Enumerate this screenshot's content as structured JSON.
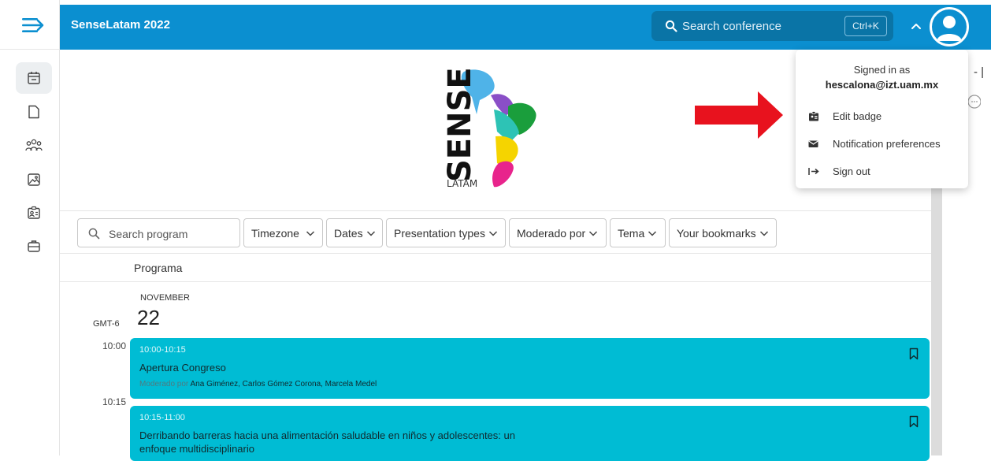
{
  "topbar": {
    "title": "SenseLatam 2022",
    "search_placeholder": "Search conference",
    "search_shortcut": "Ctrl+K"
  },
  "rail": {
    "items": [
      "calendar-icon",
      "document-icon",
      "people-icon",
      "image-icon",
      "badge-icon",
      "briefcase-icon"
    ]
  },
  "logo": {
    "text": "SENSE",
    "subtext": "LATAM"
  },
  "filters": {
    "search_placeholder": "Search program",
    "chips": [
      "Timezone",
      "Dates",
      "Presentation types",
      "Moderado por",
      "Tema",
      "Your bookmarks"
    ]
  },
  "program": {
    "heading": "Programa",
    "month": "NOVEMBER",
    "timezone": "GMT-6",
    "day": "22",
    "events": [
      {
        "start": "10:00",
        "range": "10:00-10:15",
        "title": "Apertura Congreso",
        "moderator_label": "Moderado por",
        "moderators": "Ana Giménez, Carlos Gómez Corona, Marcela Medel"
      },
      {
        "start": "10:15",
        "range": "10:15-11:00",
        "title_line1": "Derribando barreras hacia una alimentación saludable en niños y adolescentes: un",
        "title_line2": "enfoque multidisciplinario"
      }
    ]
  },
  "user_menu": {
    "signed_in_label": "Signed in as",
    "email": "hescalona@izt.uam.mx",
    "items": [
      {
        "label": "Edit badge",
        "icon": "badge-edit-icon"
      },
      {
        "label": "Notification preferences",
        "icon": "envelope-icon"
      },
      {
        "label": "Sign out",
        "icon": "sign-out-icon"
      }
    ]
  },
  "colors": {
    "primary": "#0b8fd0",
    "event": "#00bcd4",
    "arrow": "#e8121e"
  }
}
